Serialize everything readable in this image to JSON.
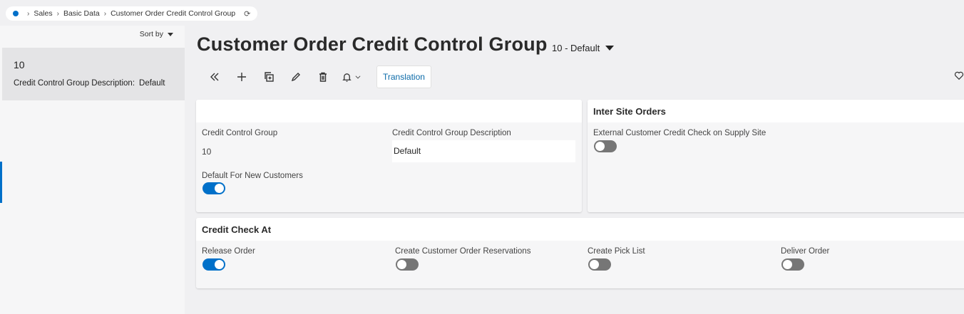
{
  "breadcrumb": {
    "items": [
      "Sales",
      "Basic Data",
      "Customer Order Credit Control Group"
    ]
  },
  "list": {
    "sort_label": "Sort by",
    "items": [
      {
        "id": "10",
        "desc_label": "Credit Control Group Description:",
        "desc_value": "Default"
      }
    ]
  },
  "header": {
    "title": "Customer Order Credit Control Group",
    "record_selector": "10 - Default"
  },
  "toolbar": {
    "translation_label": "Translation"
  },
  "general_card": {
    "credit_control_group_label": "Credit Control Group",
    "credit_control_group_value": "10",
    "description_label": "Credit Control Group Description",
    "description_value": "Default",
    "default_new_customers_label": "Default For New Customers",
    "default_new_customers_on": true
  },
  "inter_site_card": {
    "title": "Inter Site Orders",
    "external_credit_check_label": "External Customer Credit Check on Supply Site",
    "external_credit_check_on": false
  },
  "credit_check_card": {
    "title": "Credit Check At",
    "fields": [
      {
        "label": "Release Order",
        "on": true
      },
      {
        "label": "Create Customer Order Reservations",
        "on": false
      },
      {
        "label": "Create Pick List",
        "on": false
      },
      {
        "label": "Deliver Order",
        "on": false
      }
    ]
  },
  "colors": {
    "accent": "#0070c9",
    "toggle_off": "#767676",
    "link": "#0b6aa8"
  }
}
